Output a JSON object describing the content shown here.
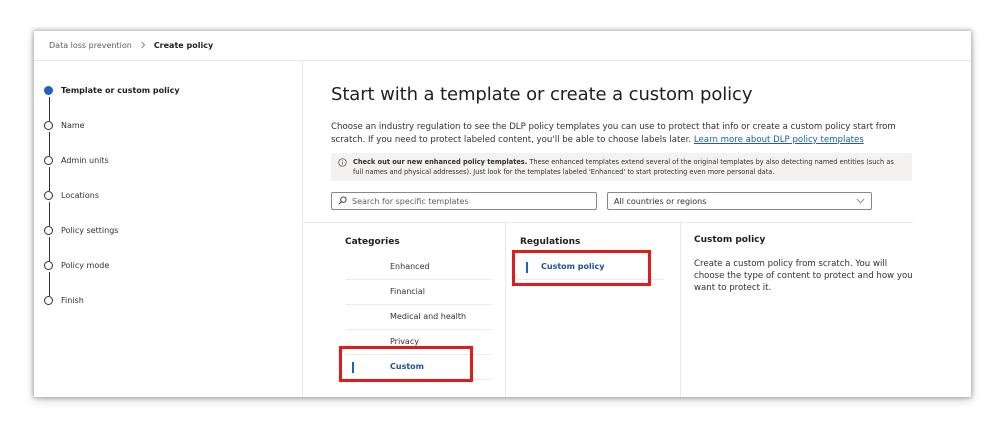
{
  "breadcrumb": {
    "parent": "Data loss prevention",
    "current": "Create policy"
  },
  "steps": [
    {
      "label": "Template or custom policy",
      "state": "current"
    },
    {
      "label": "Name",
      "state": "pending"
    },
    {
      "label": "Admin units",
      "state": "pending"
    },
    {
      "label": "Locations",
      "state": "pending"
    },
    {
      "label": "Policy settings",
      "state": "pending"
    },
    {
      "label": "Policy mode",
      "state": "pending"
    },
    {
      "label": "Finish",
      "state": "pending"
    }
  ],
  "main": {
    "title": "Start with a template or create a custom policy",
    "intro": "Choose an industry regulation to see the DLP policy templates you can use to protect that info or create a custom policy start from scratch. If you need to protect labeled content, you'll be able to choose labels later.",
    "intro_link": "Learn more about DLP policy templates",
    "notice_bold": "Check out our new enhanced policy templates.",
    "notice_text": "These enhanced templates extend several of the original templates by also detecting named entities (such as full names and physical addresses). Just look for the templates labeled 'Enhanced' to start protecting even more personal data.",
    "search_placeholder": "Search for specific templates",
    "region_value": "All countries or regions"
  },
  "categories": {
    "title": "Categories",
    "items": [
      "Enhanced",
      "Financial",
      "Medical and health",
      "Privacy",
      "Custom"
    ],
    "selected": "Custom"
  },
  "regulations": {
    "title": "Regulations",
    "items": [
      "Custom policy"
    ],
    "selected": "Custom policy"
  },
  "detail": {
    "title": "Custom policy",
    "description": "Create a custom policy from scratch. You will choose the type of content to protect and how you want to protect it."
  },
  "colors": {
    "accent": "#1f5fbf",
    "highlight": "#e21a1a",
    "link": "#1a5dab"
  },
  "icons": [
    "chevron-right-icon",
    "info-icon",
    "search-icon",
    "chevron-down-icon"
  ]
}
